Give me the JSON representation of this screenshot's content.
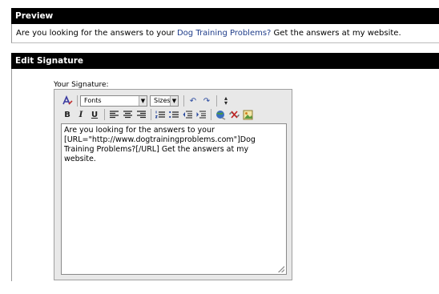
{
  "preview": {
    "title": "Preview",
    "text_before": "Are you looking for the answers to your ",
    "link_text": "Dog Training Problems?",
    "text_after": " Get the answers at my website."
  },
  "edit_signature": {
    "title": "Edit Signature",
    "label": "Your Signature:",
    "toolbar": {
      "font_select": "Fonts",
      "size_select": "Sizes",
      "icons": [
        "format-icon",
        "undo-icon",
        "redo-icon",
        "resize-icon",
        "bold-icon",
        "italic-icon",
        "underline-icon",
        "align-left-icon",
        "align-center-icon",
        "align-right-icon",
        "ordered-list-icon",
        "unordered-list-icon",
        "outdent-icon",
        "indent-icon",
        "insert-link-icon",
        "remove-link-icon",
        "insert-image-icon"
      ]
    },
    "content": "Are you looking for the answers to your\n[URL=\"http://www.dogtrainingproblems.com\"]Dog\nTraining Problems?[/URL] Get the answers at my\nwebsite."
  },
  "colors": {
    "header_bg": "#000000",
    "header_text": "#ffffff",
    "link": "#1f3d8a",
    "editor_bg": "#e8e8e8"
  }
}
